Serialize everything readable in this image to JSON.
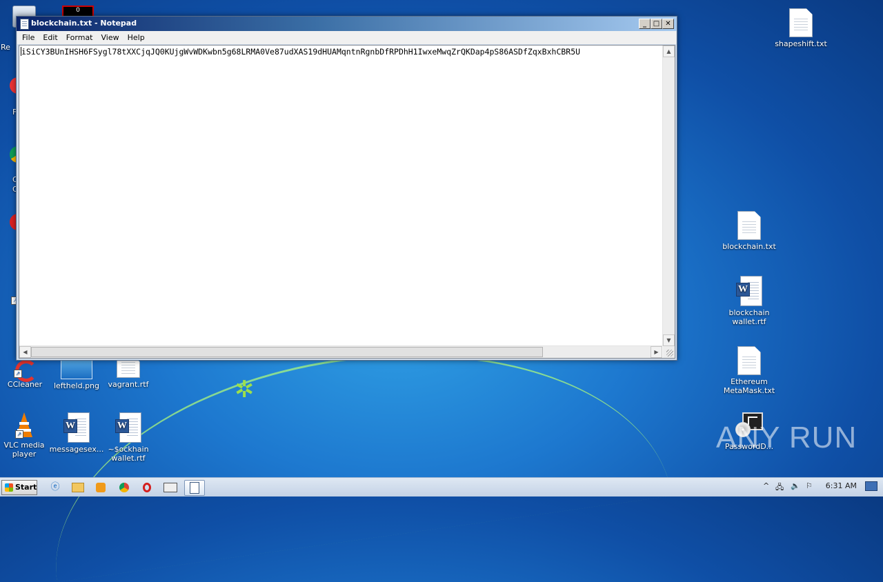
{
  "window": {
    "title": "blockchain.txt - Notepad",
    "controls": {
      "minimize": "_",
      "maximize": "□",
      "close": "✕"
    }
  },
  "menu": [
    "File",
    "Edit",
    "Format",
    "View",
    "Help"
  ],
  "editor": {
    "content": "iSiCY3BUnIHSH6FSygl78tXXCjqJQ0KUjgWvWDKwbn5g68LRMA0Ve87udXAS19dHUAMqntnRgnbDfRPDhH1IwxeMwqZrQKDap4pS86ASDfZqxBxhCBR5U"
  },
  "desktop": {
    "icons_right": [
      {
        "name": "shapeshift-txt",
        "label": "shapeshift.txt"
      },
      {
        "name": "blockchain-txt",
        "label": "blockchain.txt"
      },
      {
        "name": "blockchain-wallet-rtf",
        "label": "blockchain wallet.rtf"
      },
      {
        "name": "ethereum-metamask-txt",
        "label": "Ethereum MetaMask.txt"
      },
      {
        "name": "passwordd",
        "label": "PasswordD..."
      }
    ],
    "icons_bottom": [
      {
        "name": "ccleaner",
        "label": "CCleaner"
      },
      {
        "name": "leftheld-png",
        "label": "leftheld.png"
      },
      {
        "name": "vagrant-rtf",
        "label": "vagrant.rtf"
      },
      {
        "name": "vlc",
        "label": "VLC media player"
      },
      {
        "name": "messagesex",
        "label": "messagesex..."
      },
      {
        "name": "ockhain-wallet",
        "label": "~$ockhain wallet.rtf"
      }
    ],
    "partial_labels": {
      "recycle": "Re",
      "f": "F",
      "c1": "C",
      "c2": "C"
    },
    "watermark": "ANY RUN"
  },
  "taskbar": {
    "start": "Start",
    "clock": "6:31 AM",
    "tray_arrow": "^"
  }
}
